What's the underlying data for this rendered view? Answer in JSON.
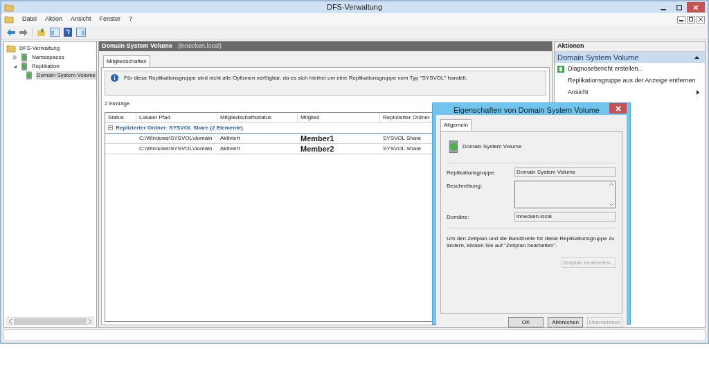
{
  "window": {
    "title": "DFS-Verwaltung"
  },
  "menu": [
    "Datei",
    "Aktion",
    "Ansicht",
    "Fenster",
    "?"
  ],
  "tree": [
    {
      "label": "DFS-Verwaltung",
      "selected": false,
      "children": [
        {
          "label": "Namespaces",
          "selected": false,
          "expanded": false
        },
        {
          "label": "Replikation",
          "selected": false,
          "expanded": true,
          "children": [
            {
              "label": "Domain System Volume",
              "selected": true
            }
          ]
        }
      ]
    }
  ],
  "content": {
    "title": "Domain System Volume",
    "subtitle": "(innecken.local)",
    "tabs": [
      {
        "label": "Mitgliedschaften",
        "selected": true
      }
    ],
    "info": "Für diese Replikationsgruppe sind nicht alle Optionen verfügbar, da es sich hierbei um eine Replikationsgruppe vom Typ \"SYSVOL\" handelt.",
    "count": "2 Einträge",
    "table": {
      "columns": [
        "Status",
        "Lokaler Pfad",
        "Mitgliedschaftsstatus",
        "Mitglied",
        "Replizierter Ordner"
      ],
      "group": "Replizierter Ordner: SYSVOL Share (2 Elemente)",
      "rows": [
        {
          "path": "C:\\Windows\\SYSVOL\\domain",
          "status": "Aktiviert",
          "member": "Member1",
          "folder": "SYSVOL Share"
        },
        {
          "path": "C:\\Windows\\SYSVOL\\domain",
          "status": "Aktiviert",
          "member": "Member2",
          "folder": "SYSVOL Share"
        }
      ]
    }
  },
  "actions": {
    "header": "Aktionen",
    "section": "Domain System Volume",
    "items": [
      {
        "label": "Diagnosebericht erstellen...",
        "kind": "icon"
      },
      {
        "label": "Replikationsgruppe aus der Anzeige entfernen",
        "kind": "plain"
      },
      {
        "label": "Ansicht",
        "kind": "submenu"
      }
    ]
  },
  "dialog": {
    "title": "Eigenschaften von Domain System Volume",
    "tabs": [
      {
        "label": "Allgemein",
        "selected": true
      }
    ],
    "name": "Domain System Volume",
    "fields": [
      {
        "label": "Replikationsgruppe:",
        "value": "Domain System Volume",
        "kind": "single"
      },
      {
        "label": "Beschreibung:",
        "kind": "multiline"
      },
      {
        "label": "Domäne:",
        "value": "innecken.local",
        "kind": "single"
      }
    ],
    "note": "Um den Zeitplan und die Bandbreite für diese Replikationsgruppe zu ändern, klicken Sie auf \"Zeitplan bearbeiten\".",
    "schedule_button": {
      "label": "Zeitplan bearbeiten...",
      "disabled": true
    },
    "buttons": [
      {
        "label": "OK",
        "disabled": false
      },
      {
        "label": "Abbrechen",
        "disabled": false
      },
      {
        "label": "Übernehmen",
        "disabled": true
      }
    ]
  }
}
